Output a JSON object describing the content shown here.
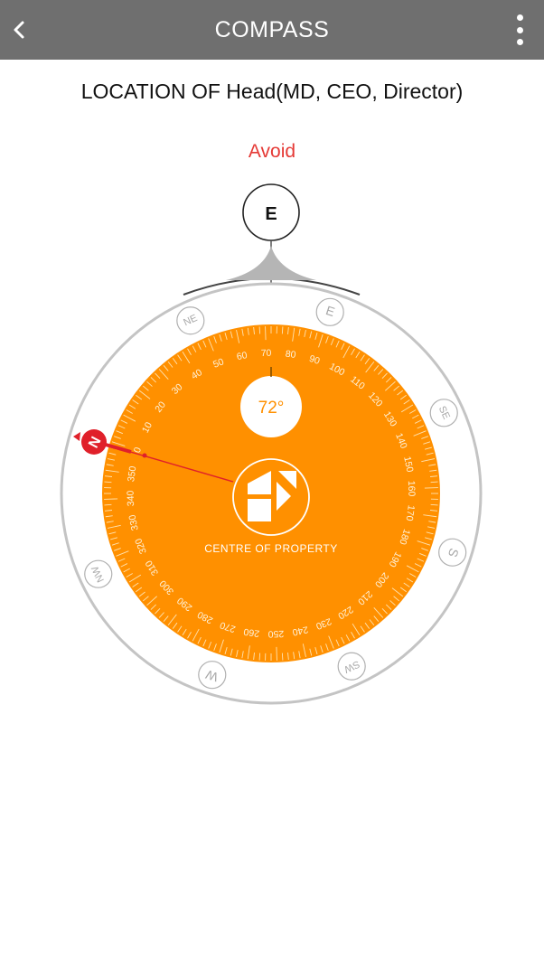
{
  "appbar": {
    "title": "COMPASS",
    "back_icon": "chevron-left-icon",
    "menu_icon": "more-vertical-icon"
  },
  "heading": "LOCATION OF Head(MD, CEO, Director)",
  "status": {
    "text": "Avoid",
    "color": "#e53935"
  },
  "compass": {
    "direction_label": "E",
    "heading_value": "72°",
    "centre_label": "CENTRE OF PROPERTY",
    "north_label": "N",
    "cardinal_labels": [
      "E",
      "SE",
      "S",
      "SW",
      "W",
      "NW",
      "NE"
    ],
    "scale_labels": [
      "0",
      "10",
      "20",
      "30",
      "40",
      "50",
      "60",
      "70",
      "80",
      "90",
      "100",
      "110",
      "120",
      "130",
      "140",
      "150",
      "160",
      "170",
      "180",
      "190",
      "200",
      "210",
      "220",
      "230",
      "240",
      "250",
      "260",
      "270",
      "280",
      "290",
      "300",
      "310",
      "320",
      "330",
      "340",
      "350"
    ],
    "dial_color": "#ff9000",
    "needle_color": "#e0202a"
  }
}
